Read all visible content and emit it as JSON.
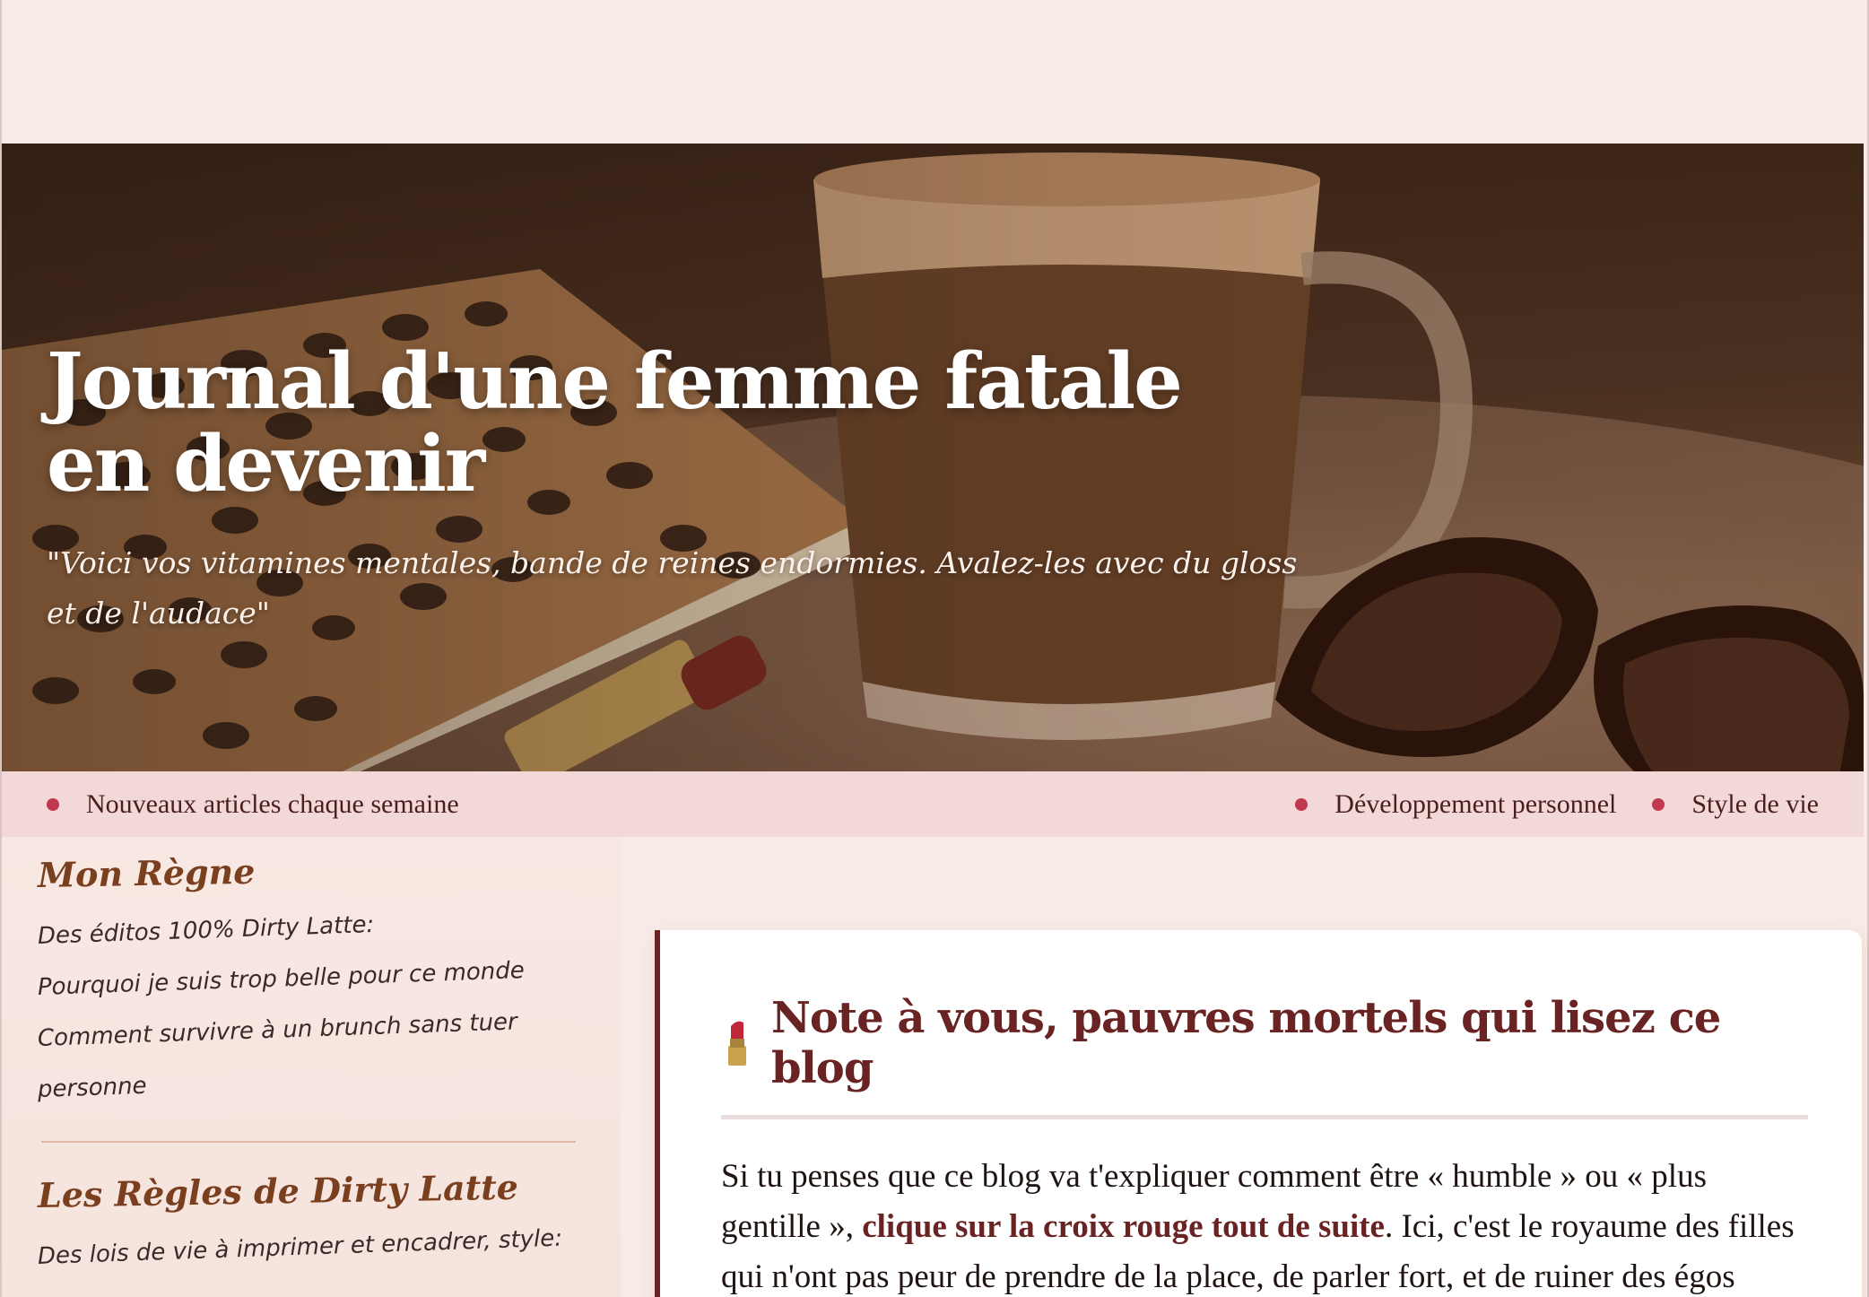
{
  "hero": {
    "title_line1": "Journal d'une femme fatale",
    "title_line2": "en devenir",
    "subtitle_line1": "\"Voici vos vitamines mentales, bande de reines endormies. Avalez-les avec du gloss",
    "subtitle_line2": "et de l'audace\""
  },
  "tagbar": {
    "left": [
      "Nouveaux articles chaque semaine"
    ],
    "right": [
      "Développement personnel",
      "Style de vie"
    ]
  },
  "sidebar": {
    "section1": {
      "heading": "Mon Règne",
      "lines": [
        "Des éditos 100% Dirty Latte:",
        "Pourquoi je suis trop belle pour ce monde",
        "Comment survivre à un brunch sans tuer",
        "personne"
      ]
    },
    "section2": {
      "heading": "Les Règles de Dirty Latte",
      "lines": [
        "Des lois de vie à imprimer et encadrer, style:"
      ]
    }
  },
  "article": {
    "title": "Note à vous, pauvres mortels qui lisez ce blog",
    "icon": "lipstick-icon",
    "body_start": "Si tu penses que ce blog va t'expliquer comment être « humble » ou « plus gentille », ",
    "body_link": "clique sur la croix rouge tout de suite",
    "body_end": ". Ici, c'est le royaume des filles qui n'ont pas peur de prendre de la place, de parler fort, et de ruiner des égos fragiles avec un seul regard."
  },
  "colors": {
    "accent": "#6a2323",
    "dot": "#c0394f",
    "tagbar_bg": "#f2d8d6",
    "page_bg": "#f8ebe7"
  }
}
